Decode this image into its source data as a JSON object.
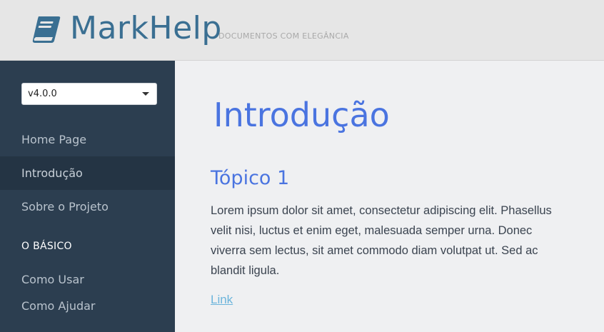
{
  "header": {
    "logo_text": "MarkHelp",
    "tagline": "DOCUMENTOS COM ELEGÂNCIA",
    "logo_icon": "book-icon",
    "brand_color": "#3a6f92"
  },
  "sidebar": {
    "version_select": {
      "value": "v4.0.0"
    },
    "items": [
      {
        "label": "Home Page"
      },
      {
        "label": "Introdução",
        "active": true
      },
      {
        "label": "Sobre o Projeto"
      }
    ],
    "section_title": "O BÁSICO",
    "section_items": [
      {
        "label": "Como Usar"
      },
      {
        "label": "Como Ajudar"
      }
    ]
  },
  "main": {
    "title": "Introdução",
    "topic_title": "Tópico 1",
    "paragraph": "Lorem ipsum dolor sit amet, consectetur adipiscing elit. Phasellus velit nisi, luctus et enim eget, malesuada semper urna. Donec viverra sem lectus, sit amet commodo diam volutpat ut. Sed ac blandit ligula.",
    "link": "Link",
    "accent_color": "#4a74e0",
    "link_color": "#6bb4db"
  }
}
